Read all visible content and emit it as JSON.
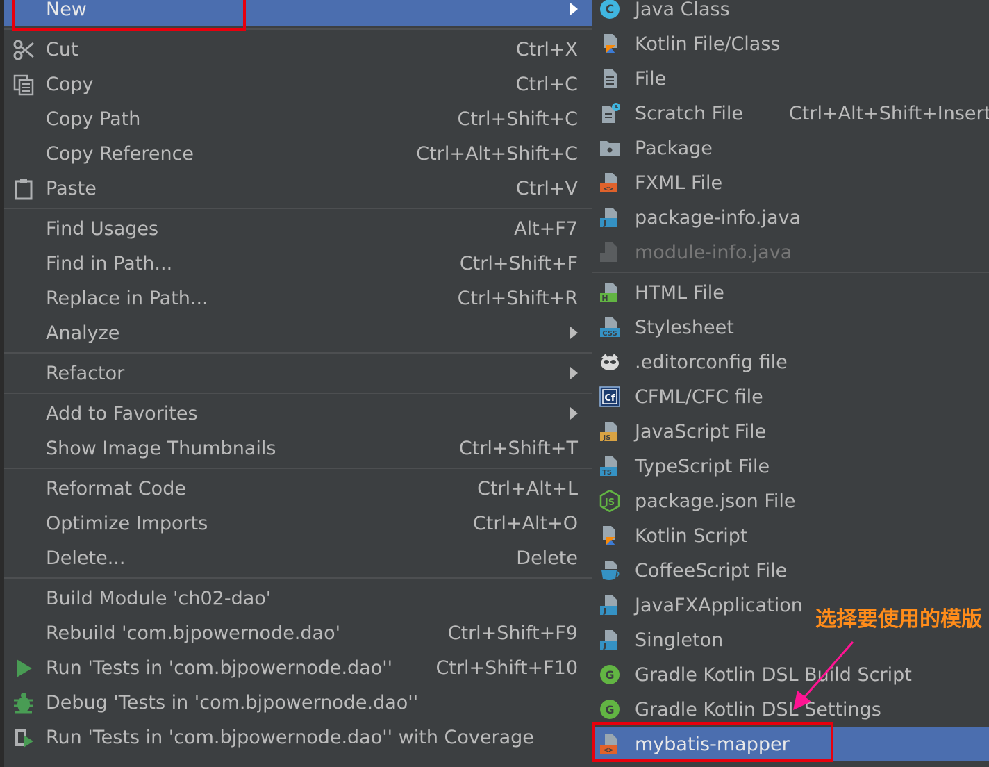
{
  "left_menu": {
    "new": {
      "label": "New"
    },
    "groups": [
      [
        {
          "key": "cut",
          "label": "Cut",
          "shortcut": "Ctrl+X",
          "icon": "scissors-icon"
        },
        {
          "key": "copy",
          "label": "Copy",
          "shortcut": "Ctrl+C",
          "icon": "copy-icon"
        },
        {
          "key": "copy-path",
          "label": "Copy Path",
          "shortcut": "Ctrl+Shift+C"
        },
        {
          "key": "copy-reference",
          "label": "Copy Reference",
          "shortcut": "Ctrl+Alt+Shift+C"
        },
        {
          "key": "paste",
          "label": "Paste",
          "shortcut": "Ctrl+V",
          "icon": "clipboard-icon"
        }
      ],
      [
        {
          "key": "find-usages",
          "label": "Find Usages",
          "shortcut": "Alt+F7"
        },
        {
          "key": "find-in-path",
          "label": "Find in Path...",
          "shortcut": "Ctrl+Shift+F"
        },
        {
          "key": "replace-in-path",
          "label": "Replace in Path...",
          "shortcut": "Ctrl+Shift+R"
        },
        {
          "key": "analyze",
          "label": "Analyze",
          "submenu": true
        }
      ],
      [
        {
          "key": "refactor",
          "label": "Refactor",
          "submenu": true
        }
      ],
      [
        {
          "key": "add-to-favorites",
          "label": "Add to Favorites",
          "submenu": true
        },
        {
          "key": "show-image-thumbnails",
          "label": "Show Image Thumbnails",
          "shortcut": "Ctrl+Shift+T"
        }
      ],
      [
        {
          "key": "reformat-code",
          "label": "Reformat Code",
          "shortcut": "Ctrl+Alt+L"
        },
        {
          "key": "optimize-imports",
          "label": "Optimize Imports",
          "shortcut": "Ctrl+Alt+O"
        },
        {
          "key": "delete",
          "label": "Delete...",
          "shortcut": "Delete"
        }
      ],
      [
        {
          "key": "build-module",
          "label": "Build Module 'ch02-dao'"
        },
        {
          "key": "rebuild",
          "label": "Rebuild 'com.bjpowernode.dao'",
          "shortcut": "Ctrl+Shift+F9"
        },
        {
          "key": "run-tests",
          "label": "Run 'Tests in 'com.bjpowernode.dao''",
          "shortcut": "Ctrl+Shift+F10",
          "icon": "run-icon"
        },
        {
          "key": "debug-tests",
          "label": "Debug 'Tests in 'com.bjpowernode.dao''",
          "icon": "debug-bug-icon"
        },
        {
          "key": "run-coverage",
          "label": "Run 'Tests in 'com.bjpowernode.dao'' with Coverage",
          "icon": "coverage-icon"
        }
      ]
    ]
  },
  "right_menu": {
    "groups": [
      [
        {
          "key": "java-class",
          "label": "Java Class",
          "icon": "java-class-icon"
        },
        {
          "key": "kotlin-file-class",
          "label": "Kotlin File/Class",
          "icon": "kotlin-file-icon"
        },
        {
          "key": "file",
          "label": "File",
          "icon": "file-icon"
        },
        {
          "key": "scratch-file",
          "label": "Scratch File",
          "shortcut": "Ctrl+Alt+Shift+Insert",
          "icon": "scratch-file-icon"
        },
        {
          "key": "package",
          "label": "Package",
          "icon": "package-folder-icon"
        },
        {
          "key": "fxml-file",
          "label": "FXML File",
          "icon": "fxml-file-icon"
        },
        {
          "key": "package-info",
          "label": "package-info.java",
          "icon": "java-file-icon"
        },
        {
          "key": "module-info",
          "label": "module-info.java",
          "disabled": true,
          "icon": "module-info-icon"
        }
      ],
      [
        {
          "key": "html-file",
          "label": "HTML File",
          "icon": "html-file-icon"
        },
        {
          "key": "stylesheet",
          "label": "Stylesheet",
          "icon": "css-file-icon"
        },
        {
          "key": "editorconfig",
          "label": ".editorconfig file",
          "icon": "editorconfig-icon"
        },
        {
          "key": "cfml-cfc",
          "label": "CFML/CFC file",
          "icon": "cfml-icon"
        },
        {
          "key": "javascript-file",
          "label": "JavaScript File",
          "icon": "javascript-file-icon"
        },
        {
          "key": "typescript-file",
          "label": "TypeScript File",
          "icon": "typescript-file-icon"
        },
        {
          "key": "package-json",
          "label": "package.json File",
          "icon": "nodejs-icon"
        },
        {
          "key": "kotlin-script",
          "label": "Kotlin Script",
          "icon": "kotlin-script-icon"
        },
        {
          "key": "coffeescript-file",
          "label": "CoffeeScript File",
          "icon": "coffeescript-icon"
        },
        {
          "key": "javafx-application",
          "label": "JavaFXApplication",
          "icon": "java-file-icon"
        },
        {
          "key": "singleton",
          "label": "Singleton",
          "icon": "java-file-icon"
        },
        {
          "key": "gradle-build",
          "label": "Gradle Kotlin DSL Build Script",
          "icon": "gradle-icon"
        },
        {
          "key": "gradle-settings",
          "label": "Gradle Kotlin DSL Settings",
          "icon": "gradle-icon"
        },
        {
          "key": "mybatis-mapper",
          "label": "mybatis-mapper",
          "selected": true,
          "icon": "xml-file-icon"
        }
      ]
    ]
  },
  "annotation": {
    "text": "选择要使用的模版"
  },
  "colors": {
    "menu_bg": "#3c3f41",
    "selection": "#4b6eaf",
    "text": "#bbbbbb",
    "highlight_box": "#e8000d",
    "annotation": "#ff8c1a",
    "arrow": "#ff1493"
  }
}
